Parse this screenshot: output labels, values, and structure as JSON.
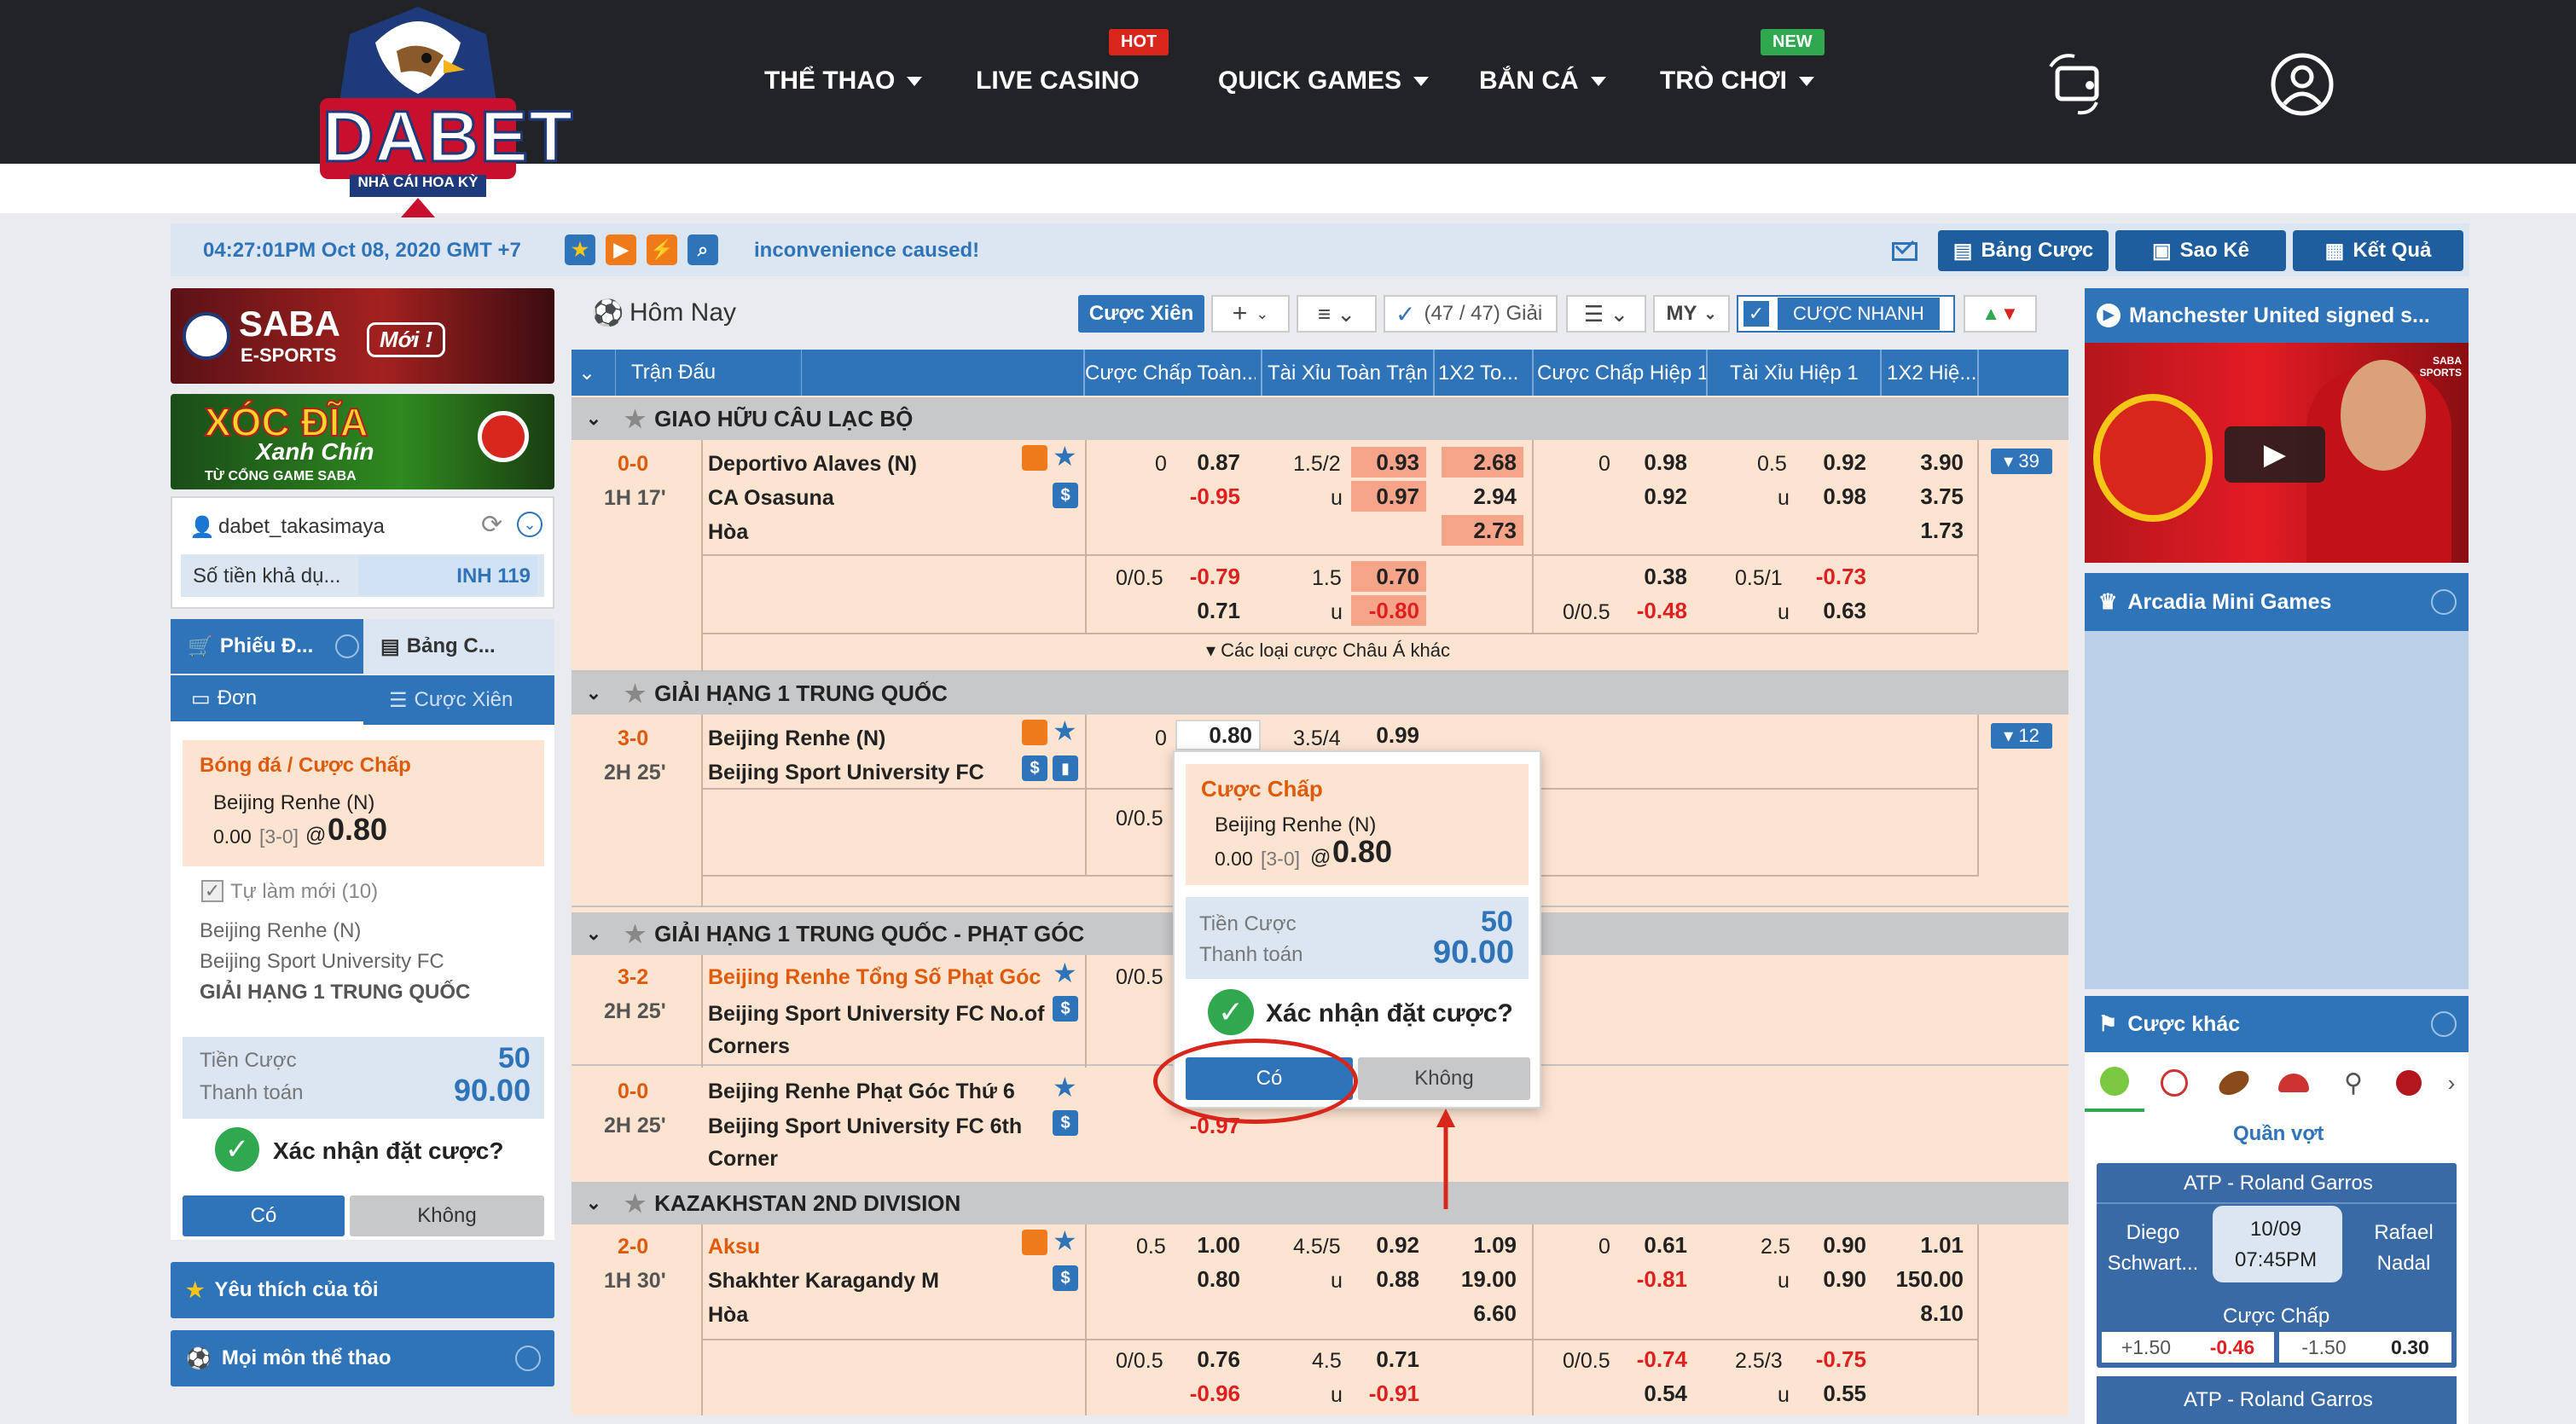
{
  "header": {
    "brand": "DABET",
    "brand_sub": "NHÀ CÁI HOA KỲ",
    "nav": [
      {
        "label": "THỂ THAO",
        "dropdown": true
      },
      {
        "label": "LIVE CASINO",
        "dropdown": false,
        "badge": "HOT"
      },
      {
        "label": "QUICK GAMES",
        "dropdown": true
      },
      {
        "label": "BẮN CÁ",
        "dropdown": true
      },
      {
        "label": "TRÒ CHƠI",
        "dropdown": true,
        "badge": "NEW"
      }
    ],
    "icons": [
      "wallet-transfer-icon",
      "user-avatar-icon"
    ]
  },
  "infobar": {
    "datetime": "04:27:01PM Oct 08, 2020 GMT +7",
    "marquee": "inconvenience caused!",
    "buttons": [
      "Bảng Cược",
      "Sao Kê",
      "Kết Quả"
    ]
  },
  "left": {
    "banner1": {
      "title": "SABA",
      "sub": "E-SPORTS",
      "tag": "Mới !"
    },
    "banner2": {
      "title": "XÓC ĐĨA",
      "sub": "Xanh Chín",
      "tag": "TỪ CỔNG GAME SABA"
    },
    "username": "dabet_takasimaya",
    "balance_label": "Số tiền khả dụ...",
    "balance_value": "INH 119",
    "tabs": [
      "Phiếu Đ...",
      "Bảng C..."
    ],
    "subtabs": [
      "Đơn",
      "Cược Xiên"
    ],
    "slip": {
      "type": "Bóng đá / Cược Chấp",
      "team": "Beijing Renhe (N)",
      "line": "0.00",
      "score": "[3-0]",
      "at": "@",
      "odds": "0.80",
      "auto_label": "Tự làm mới (10)",
      "home": "Beijing Renhe (N)",
      "away": "Beijing Sport University FC",
      "league": "GIẢI HẠNG 1 TRUNG QUỐC",
      "stake_label": "Tiền Cược",
      "stake": "50",
      "pay_label": "Thanh toán",
      "pay": "90.00",
      "confirm": "Xác nhận đặt cược?",
      "yes": "Có",
      "no": "Không"
    },
    "favorites": "Yêu thích của tôi",
    "all_sports": "Mọi môn thể thao"
  },
  "main": {
    "title": "Hôm Nay",
    "toolbar": {
      "parlay": "Cược Xiên",
      "plus": "+",
      "leagues": "(47 / 47) Giải",
      "odds_type": "MY",
      "quick": "CƯỢC NHANH"
    },
    "columns": [
      "Trận Đấu",
      "Cược Chấp Toàn...",
      "Tài Xỉu Toàn Trận",
      "1X2 To...",
      "Cược Chấp Hiệp 1",
      "Tài Xỉu Hiệp 1",
      "1X2 Hiệ..."
    ],
    "leagues": [
      {
        "name": "GIAO HỮU CÂU LẠC BỘ",
        "score": "0-0",
        "time": "1H 17'",
        "home": "Deportivo Alaves (N)",
        "away": "CA Osasuna",
        "draw": "Hòa",
        "more": "39",
        "r1": {
          "hdp": "0",
          "hdp_h": "0.87",
          "hdp_a": "-0.95",
          "ou": "1.5/2",
          "ou_u": "u",
          "ou_o": "0.93",
          "ou_uo": "0.97",
          "x1": "2.68",
          "x2": "2.94",
          "xd": "2.73",
          "h1": "0",
          "h1_h": "0.98",
          "h1_a": "0.92",
          "h1ou": "0.5",
          "h1ou_u": "u",
          "h1ou_o": "0.92",
          "h1ou_uo": "0.98",
          "h1x1": "3.90",
          "h1x2": "3.75",
          "h1xd": "1.73"
        },
        "r2": {
          "hdp": "0/0.5",
          "hdp_h": "-0.79",
          "hdp_a": "0.71",
          "ou": "1.5",
          "ou_u": "u",
          "ou_o": "0.70",
          "ou_uo": "-0.80",
          "h1_h": "0.38",
          "h1": "0/0.5",
          "h1_a": "-0.48",
          "h1ou": "0.5/1",
          "h1ou_u": "u",
          "h1ou_o": "-0.73",
          "h1ou_uo": "0.63"
        },
        "other": "▾ Các loại cược Châu Á khác"
      },
      {
        "name": "GIẢI HẠNG 1 TRUNG QUỐC",
        "score": "3-0",
        "time": "2H 25'",
        "home": "Beijing Renhe (N)",
        "away": "Beijing Sport University FC",
        "more": "12",
        "r1": {
          "hdp": "0",
          "hdp_h": "0.80",
          "ou": "3.5/4",
          "ou_o": "0.99"
        },
        "r2": {
          "hdp": "0/0.5"
        }
      },
      {
        "name": "GIẢI HẠNG 1 TRUNG QUỐC - PHẠT GÓC",
        "m1": {
          "score": "3-2",
          "time": "2H 25'",
          "home": "Beijing Renhe Tổng Số Phạt Góc",
          "away": "Beijing Sport University FC No.of Corners",
          "hdp": "0/0.5"
        },
        "m2": {
          "score": "0-0",
          "time": "2H 25'",
          "home": "Beijing Renhe Phạt Góc Thứ 6",
          "away": "Beijing Sport University FC 6th Corner",
          "hdp_a": "-0.97"
        }
      },
      {
        "name": "KAZAKHSTAN 2ND DIVISION",
        "score": "2-0",
        "time": "1H 30'",
        "home": "Aksu",
        "away": "Shakhter Karagandy M",
        "draw": "Hòa",
        "r1": {
          "hdp": "0.5",
          "hdp_h": "1.00",
          "hdp_a": "0.80",
          "ou": "4.5/5",
          "ou_u": "u",
          "ou_o": "0.92",
          "ou_uo": "0.88",
          "x1": "1.09",
          "x2": "19.00",
          "xd": "6.60",
          "h1": "0",
          "h1_h": "0.61",
          "h1_a": "-0.81",
          "h1ou": "2.5",
          "h1ou_u": "u",
          "h1ou_o": "0.90",
          "h1ou_uo": "0.90",
          "h1x1": "1.01",
          "h1x2": "150.00",
          "h1xd": "8.10"
        },
        "r2": {
          "hdp": "0/0.5",
          "hdp_h": "0.76",
          "hdp_a": "-0.96",
          "ou": "4.5",
          "ou_u": "u",
          "ou_o": "0.71",
          "ou_uo": "-0.91",
          "h1": "0/0.5",
          "h1_h": "-0.74",
          "h1_a": "0.54",
          "h1ou": "2.5/3",
          "h1ou_u": "u",
          "h1ou_o": "-0.75",
          "h1ou_uo": "0.55"
        }
      }
    ]
  },
  "popup": {
    "type": "Cược Chấp",
    "team": "Beijing Renhe (N)",
    "line": "0.00",
    "score": "[3-0]",
    "at": "@",
    "odds": "0.80",
    "stake_label": "Tiền Cược",
    "stake": "50",
    "pay_label": "Thanh toán",
    "pay": "90.00",
    "confirm": "Xác nhận đặt cược?",
    "yes": "Có",
    "no": "Không"
  },
  "right": {
    "video_title": "Manchester United signed s...",
    "video_brand": "SABA SPORTS",
    "mini_games": "Arcadia Mini Games",
    "other_bets": "Cược khác",
    "sport_label": "Quần vợt",
    "card": {
      "tournament": "ATP - Roland Garros",
      "p1": "Diego Schwart...",
      "p2": "Rafael Nadal",
      "date": "10/09",
      "time": "07:45PM",
      "market": "Cược Chấp",
      "l1": "+1.50",
      "o1": "-0.46",
      "l2": "-1.50",
      "o2": "0.30"
    },
    "card2": "ATP - Roland Garros"
  },
  "colors": {
    "brand_blue": "#2f73b8",
    "header": "#222326",
    "row_bg": "#fde4d1",
    "orange": "#e05a0c",
    "red_odds": "#e02020",
    "highlight": "#f6a489",
    "annotation": "#d9261c"
  }
}
